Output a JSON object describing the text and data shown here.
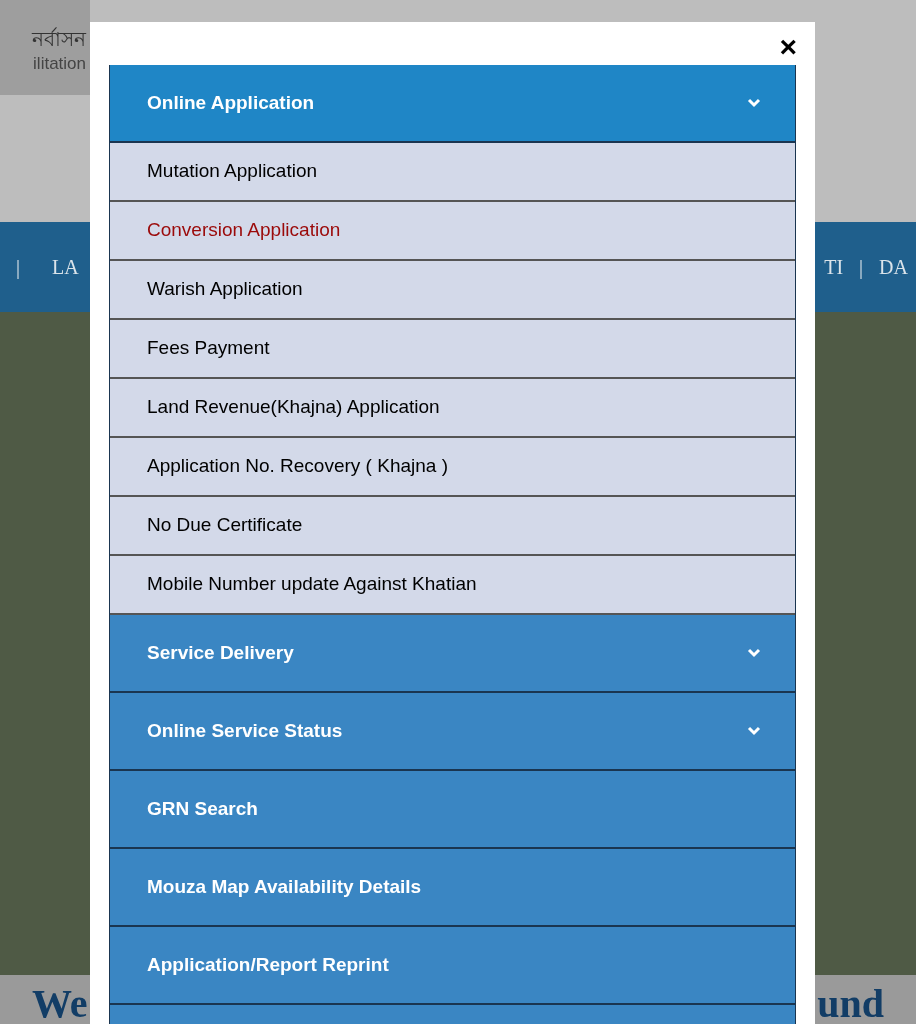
{
  "background": {
    "header_bengali": "নর্বাসন",
    "header_english": "ilitation",
    "nav": [
      "|",
      "LA",
      "TI",
      "|",
      "DA"
    ],
    "heading_left": "We",
    "heading_right": "und"
  },
  "modal": {
    "close": "×",
    "sections": [
      {
        "label": "Online Application",
        "kind": "dropdown",
        "expanded": true,
        "items": [
          {
            "label": "Mutation Application",
            "selected": false
          },
          {
            "label": "Conversion Application",
            "selected": true
          },
          {
            "label": "Warish Application",
            "selected": false
          },
          {
            "label": "Fees Payment",
            "selected": false
          },
          {
            "label": "Land Revenue(Khajna) Application",
            "selected": false
          },
          {
            "label": "Application No. Recovery ( Khajna )",
            "selected": false
          },
          {
            "label": "No Due Certificate",
            "selected": false
          },
          {
            "label": "Mobile Number update Against Khatian",
            "selected": false
          }
        ]
      },
      {
        "label": "Service Delivery",
        "kind": "dropdown",
        "expanded": false
      },
      {
        "label": "Online Service Status",
        "kind": "dropdown",
        "expanded": false
      },
      {
        "label": "GRN Search",
        "kind": "link"
      },
      {
        "label": "Mouza Map Availability Details",
        "kind": "link"
      },
      {
        "label": "Application/Report Reprint",
        "kind": "link"
      }
    ]
  }
}
